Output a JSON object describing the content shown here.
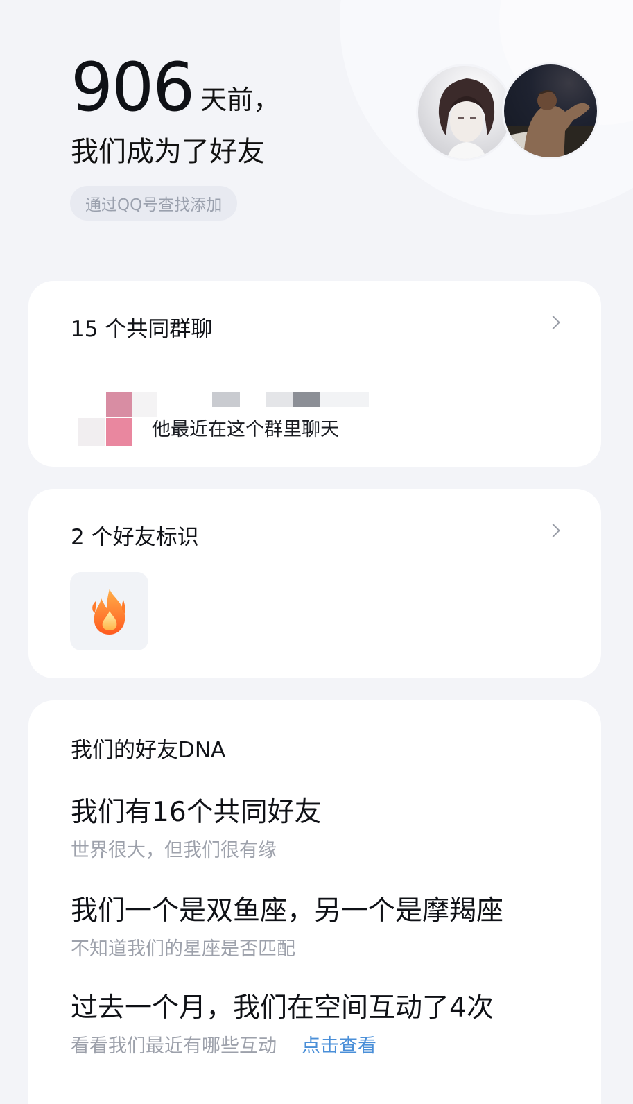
{
  "header": {
    "days_number": "906",
    "days_unit": "天前，",
    "friend_line": "我们成为了好友",
    "source": "通过QQ号查找添加"
  },
  "avatars": [
    {
      "name": "anime-avatar"
    },
    {
      "name": "photo-avatar"
    }
  ],
  "groups": {
    "title": "15 个共同群聊",
    "tip": "他最近在这个群里聊天"
  },
  "badges": {
    "title": "2 个好友标识",
    "items": [
      {
        "icon": "flame-icon"
      }
    ]
  },
  "dna": {
    "title": "我们的好友DNA",
    "items": [
      {
        "title": "我们有16个共同好友",
        "subtitle": "世界很大，但我们很有缘"
      },
      {
        "title": "我们一个是双鱼座，另一个是摩羯座",
        "subtitle": "不知道我们的星座是否匹配"
      },
      {
        "title": "过去一个月，我们在空间互动了4次",
        "subtitle": "看看我们最近有哪些互动",
        "link": "点击查看"
      }
    ]
  },
  "colors": {
    "background": "#f3f4f8",
    "card": "#ffffff",
    "link": "#4a8fd8",
    "muted": "#9da1ab"
  }
}
